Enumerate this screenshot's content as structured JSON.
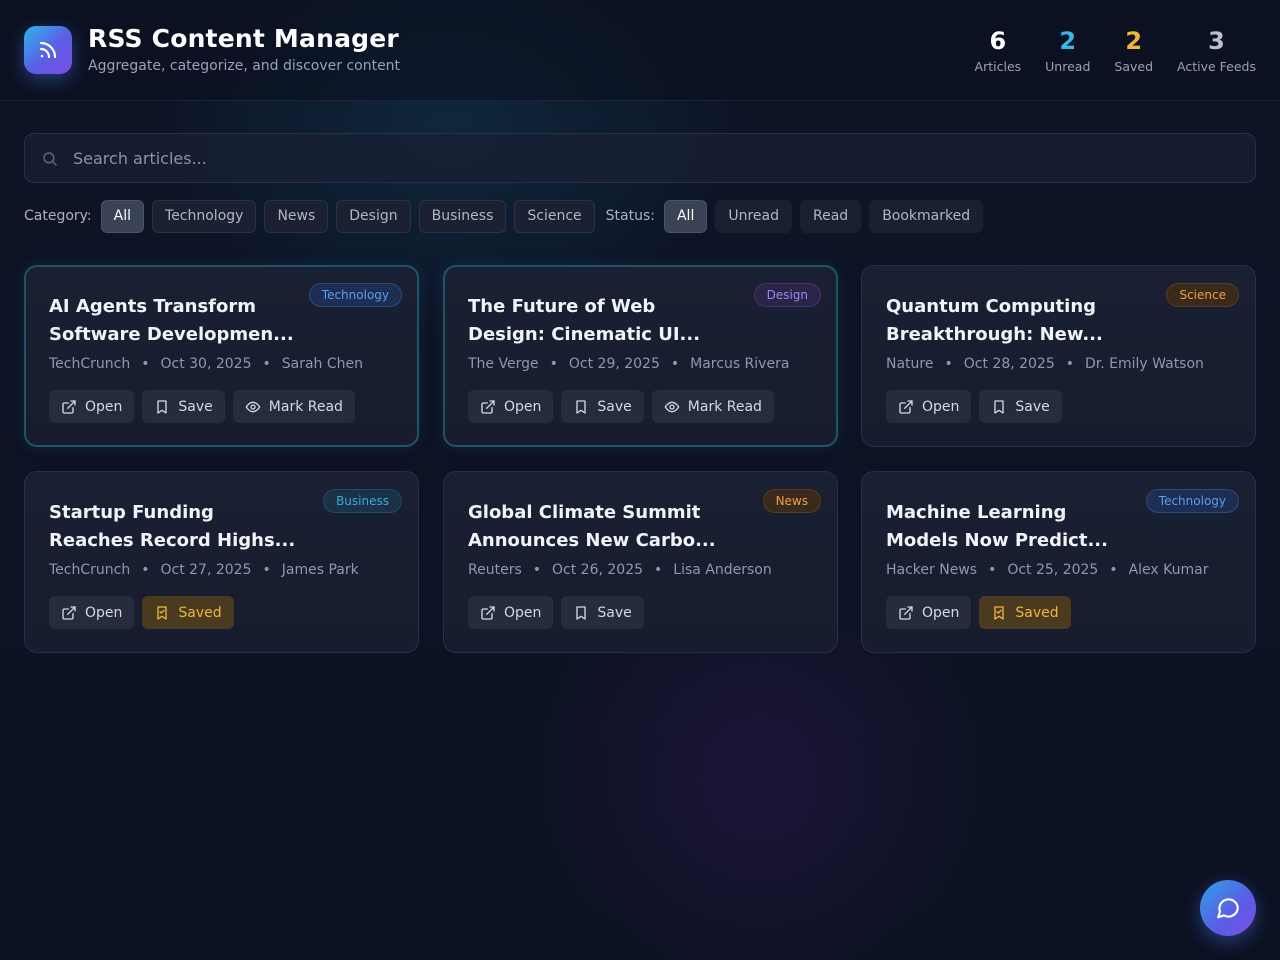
{
  "app": {
    "title": "RSS Content Manager",
    "subtitle": "Aggregate, categorize, and discover content"
  },
  "stats": [
    {
      "value": "6",
      "label": "Articles",
      "color": "#ffffff"
    },
    {
      "value": "2",
      "label": "Unread",
      "color": "#38b6ea"
    },
    {
      "value": "2",
      "label": "Saved",
      "color": "#f0b63a"
    },
    {
      "value": "3",
      "label": "Active Feeds",
      "color": "#b8c0d0"
    }
  ],
  "search": {
    "placeholder": "Search articles...",
    "value": ""
  },
  "filters": {
    "category_label": "Category:",
    "categories": [
      "All",
      "Technology",
      "News",
      "Design",
      "Business",
      "Science"
    ],
    "selected_category": "All",
    "status_label": "Status:",
    "statuses": [
      "All",
      "Unread",
      "Read",
      "Bookmarked"
    ],
    "selected_status": "All"
  },
  "buttons": {
    "open": "Open",
    "save": "Save",
    "saved": "Saved",
    "mark_read": "Mark Read"
  },
  "articles": [
    {
      "title_line1": "AI Agents Transform",
      "title_line2": "Software Developmen...",
      "category": "Technology",
      "source": "TechCrunch",
      "date": "Oct 30, 2025",
      "author": "Sarah Chen",
      "unread": true,
      "saved": false
    },
    {
      "title_line1": "The Future of Web",
      "title_line2": "Design: Cinematic UI...",
      "category": "Design",
      "source": "The Verge",
      "date": "Oct 29, 2025",
      "author": "Marcus Rivera",
      "unread": true,
      "saved": false
    },
    {
      "title_line1": "Quantum Computing",
      "title_line2": "Breakthrough: New...",
      "category": "Science",
      "source": "Nature",
      "date": "Oct 28, 2025",
      "author": "Dr. Emily Watson",
      "unread": false,
      "saved": false
    },
    {
      "title_line1": "Startup Funding",
      "title_line2": "Reaches Record Highs...",
      "category": "Business",
      "source": "TechCrunch",
      "date": "Oct 27, 2025",
      "author": "James Park",
      "unread": false,
      "saved": true
    },
    {
      "title_line1": "Global Climate Summit",
      "title_line2": "Announces New Carbo...",
      "category": "News",
      "source": "Reuters",
      "date": "Oct 26, 2025",
      "author": "Lisa Anderson",
      "unread": false,
      "saved": false
    },
    {
      "title_line1": "Machine Learning",
      "title_line2": "Models Now Predict...",
      "category": "Technology",
      "source": "Hacker News",
      "date": "Oct 25, 2025",
      "author": "Alex Kumar",
      "unread": false,
      "saved": true
    }
  ],
  "category_colors": {
    "Technology": {
      "bg": "#1c2f52",
      "fg": "#5b9cf0",
      "border": "#2a4a7a"
    },
    "Design": {
      "bg": "#2a2448",
      "fg": "#9a86f0",
      "border": "#3f3670"
    },
    "Science": {
      "bg": "#3a2a1c",
      "fg": "#f0a040",
      "border": "#553b22"
    },
    "Business": {
      "bg": "#1a3148",
      "fg": "#3ea8d8",
      "border": "#24486a"
    },
    "News": {
      "bg": "#3a2a1c",
      "fg": "#f0a040",
      "border": "#553b22"
    }
  },
  "icons": {
    "logo": "rss-icon",
    "search": "search-icon",
    "open": "external-link-icon",
    "save": "bookmark-icon",
    "saved": "bookmark-check-icon",
    "mark_read": "eye-icon",
    "chat": "chat-bubble-icon"
  }
}
